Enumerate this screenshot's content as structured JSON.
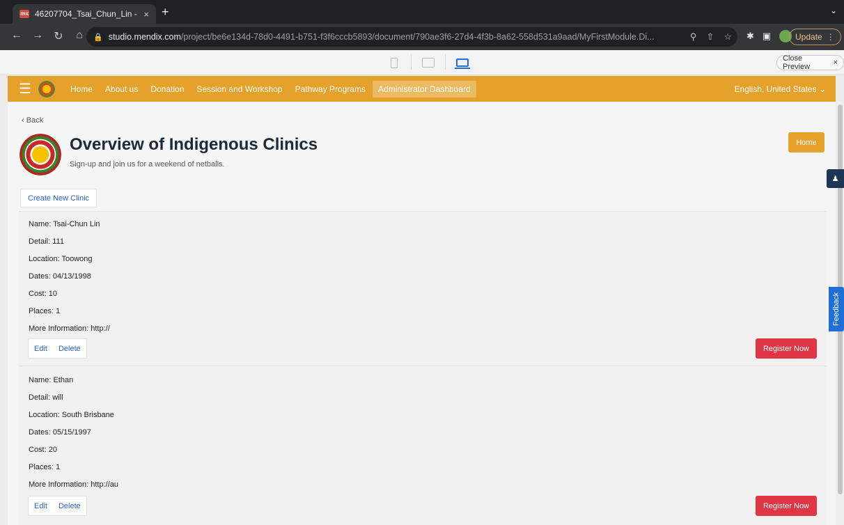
{
  "browser": {
    "tab_title": "46207704_Tsai_Chun_Lin - [D",
    "tab_close": "×",
    "new_tab": "+",
    "url_host": "studio.mendix.com",
    "url_path": "/project/be6e134d-78d0-4491-b751-f3f6cccb5893/document/790ae3f6-27d4-4f3b-8a62-558d531a9aad/MyFirstModule.Di...",
    "update_label": "Update"
  },
  "preview": {
    "close_label": "Close Preview"
  },
  "nav": {
    "links": [
      "Home",
      "About us",
      "Donation",
      "Session and Workshop",
      "Pathway Programs",
      "Administrator Dashboard"
    ],
    "language": "English, United States"
  },
  "page": {
    "back": "Back",
    "title": "Overview of Indigenous Clinics",
    "subtitle": "Sign-up and join us for a weekend of netballs.",
    "home_button": "Home",
    "create_button": "Create New Clinic"
  },
  "clinics": [
    {
      "name": "Name: Tsai-Chun Lin",
      "detail": "Detail: 111",
      "location": "Location: Toowong",
      "dates": "Dates: 04/13/1998",
      "cost": "Cost: 10",
      "places": "Places: 1",
      "info": "More Information: http://"
    },
    {
      "name": "Name: Ethan",
      "detail": "Detail: will",
      "location": "Location: South Brisbane",
      "dates": "Dates: 05/15/1997",
      "cost": "Cost: 20",
      "places": "Places: 1",
      "info": "More Information: http://au"
    }
  ],
  "actions": {
    "edit": "Edit",
    "delete": "Delete",
    "register": "Register Now"
  },
  "side": {
    "feedback": "Feedback"
  },
  "colors": {
    "brand_orange": "#e5a12a",
    "register_red": "#e03545",
    "link_blue": "#2c63d3"
  }
}
